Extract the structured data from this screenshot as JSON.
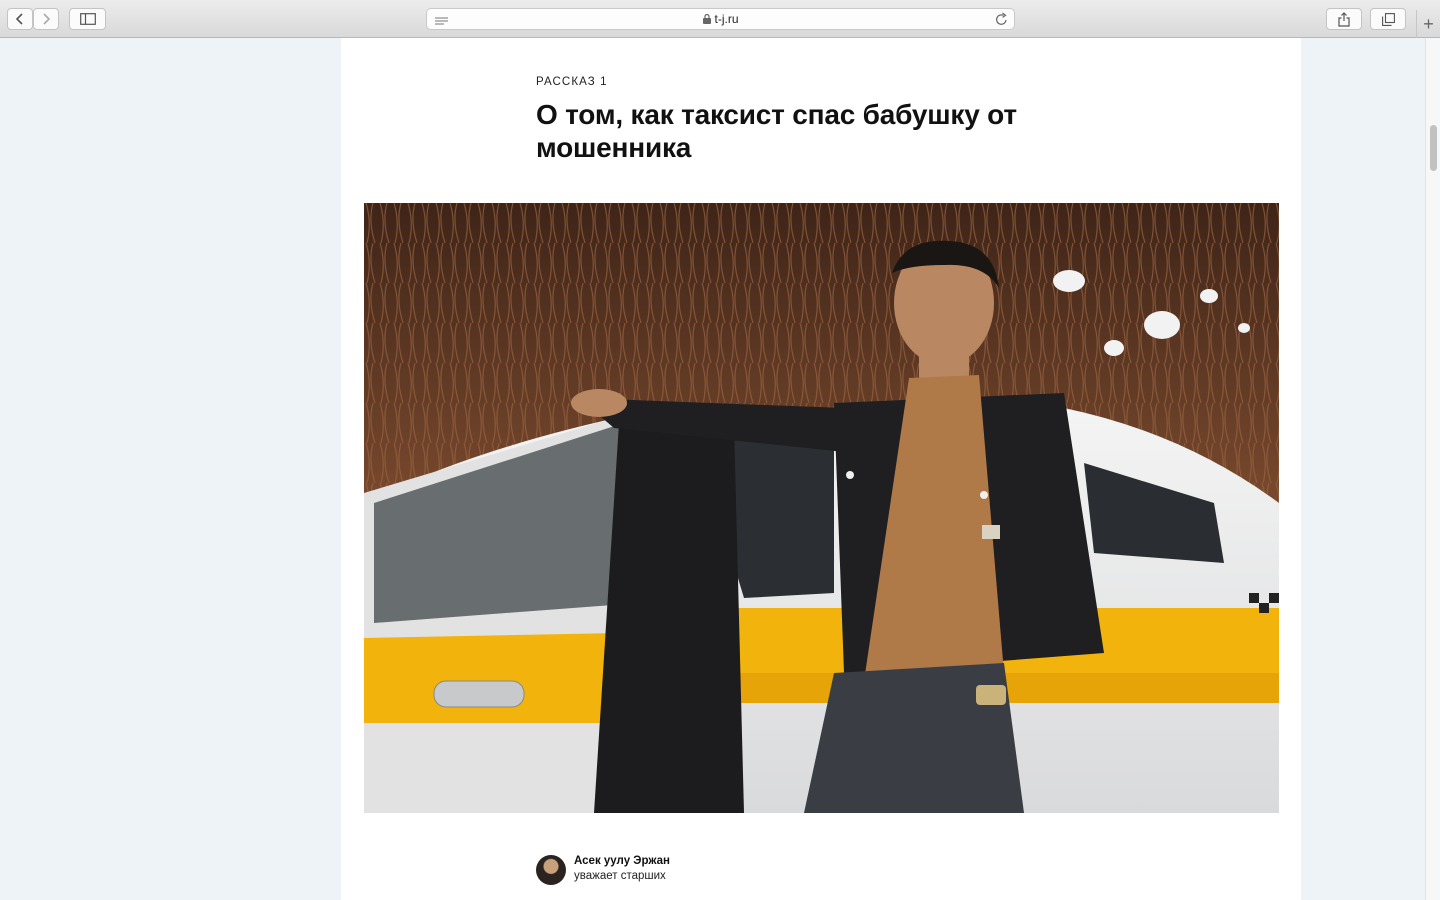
{
  "browser": {
    "url": "t-j.ru",
    "back_icon": "chevron-left-icon",
    "forward_icon": "chevron-right-icon",
    "sidebar_icon": "sidebar-icon",
    "share_icon": "share-icon",
    "tabs_icon": "tabs-overview-icon",
    "new_tab_label": "+"
  },
  "article": {
    "kicker": "РАССКАЗ 1",
    "title": "О том, как таксист спас бабушку от мошенника",
    "author": {
      "name": "Асек уулу Эржан",
      "description": "уважает старших"
    }
  },
  "colors": {
    "page_bg": "#edf3f7",
    "article_bg": "#ffffff",
    "taxi_yellow": "#f2b40c"
  }
}
